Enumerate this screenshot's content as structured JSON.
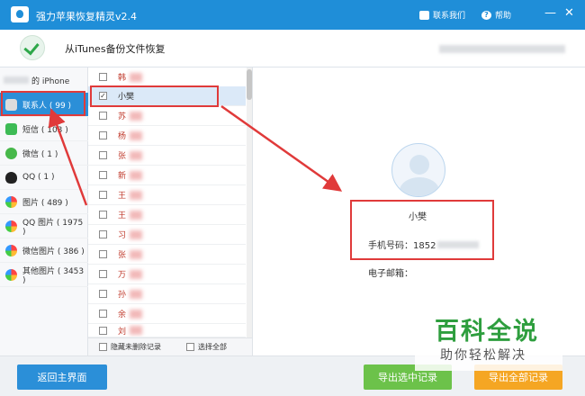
{
  "app": {
    "title": "强力苹果恢复精灵v2.4",
    "contact_label": "联系我们",
    "help_label": "帮助",
    "minimize": "—",
    "close": "✕"
  },
  "header": {
    "title": "从iTunes备份文件恢复"
  },
  "sidebar": {
    "device_label": "的 iPhone",
    "items": [
      {
        "label": "联系人 ( 99 )",
        "icon": "contacts-icon",
        "active": true
      },
      {
        "label": "短信 ( 103 )",
        "icon": "sms-icon"
      },
      {
        "label": "微信 ( 1 )",
        "icon": "wechat-icon"
      },
      {
        "label": "QQ ( 1 )",
        "icon": "qq-icon"
      },
      {
        "label": "图片 ( 489 )",
        "icon": "photos-icon"
      },
      {
        "label": "QQ 图片 ( 1975 )",
        "icon": "qq-photos-icon"
      },
      {
        "label": "微信图片 ( 386 )",
        "icon": "wechat-photos-icon"
      },
      {
        "label": "其他图片 ( 3453 )",
        "icon": "other-photos-icon"
      }
    ]
  },
  "contacts": {
    "rows": [
      {
        "name": "韩",
        "checked": false
      },
      {
        "name": "小樊",
        "checked": true
      },
      {
        "name": "苏",
        "checked": false
      },
      {
        "name": "杨",
        "checked": false
      },
      {
        "name": "张",
        "checked": false
      },
      {
        "name": "新",
        "checked": false
      },
      {
        "name": "王",
        "checked": false
      },
      {
        "name": "王",
        "checked": false
      },
      {
        "name": "习",
        "checked": false
      },
      {
        "name": "张",
        "checked": false
      },
      {
        "name": "万",
        "checked": false
      },
      {
        "name": "孙",
        "checked": false
      },
      {
        "name": "余",
        "checked": false
      },
      {
        "name": "刘",
        "checked": false
      }
    ],
    "hide_deleted_label": "隐藏未删除记录",
    "select_all_label": "选择全部"
  },
  "detail": {
    "name": "小樊",
    "phone_label": "手机号码：1852",
    "email_label": "电子邮箱："
  },
  "buttons": {
    "back_home": "返回主界面",
    "export_selected": "导出选中记录",
    "export_all": "导出全部记录"
  },
  "watermark": {
    "title": "百科全说",
    "subtitle": "助你轻松解决"
  },
  "colors": {
    "titlebar": "#1f8ed8",
    "accent_green": "#6cc24a",
    "accent_orange": "#f5a623",
    "annotation_red": "#e03a3a"
  }
}
